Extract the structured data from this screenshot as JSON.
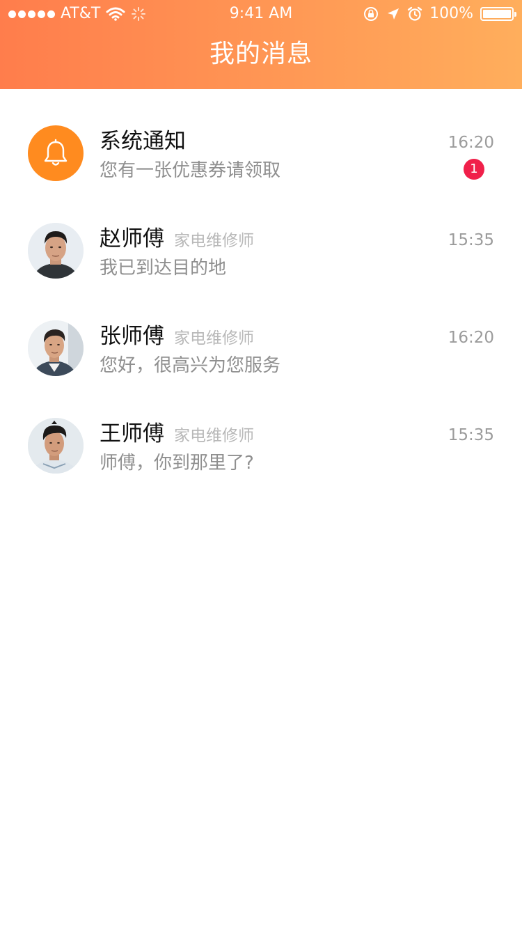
{
  "status_bar": {
    "carrier": "AT&T",
    "time": "9:41 AM",
    "battery": "100%"
  },
  "header": {
    "title": "我的消息"
  },
  "messages": [
    {
      "name": "系统通知",
      "role": "",
      "preview": "您有一张优惠券请领取",
      "time": "16:20",
      "badge": "1",
      "avatar_icon": "bell-icon"
    },
    {
      "name": "赵师傅",
      "role": "家电维修师",
      "preview": "我已到达目的地",
      "time": "15:35"
    },
    {
      "name": "张师傅",
      "role": "家电维修师",
      "preview": "您好，很高兴为您服务",
      "time": "16:20"
    },
    {
      "name": "王师傅",
      "role": "家电维修师",
      "preview": "师傅，你到那里了?",
      "time": "15:35"
    }
  ],
  "colors": {
    "header_start": "#ff7d4c",
    "header_end": "#ffae5c",
    "system_avatar": "#ff8b1f",
    "badge": "#f0204a"
  }
}
